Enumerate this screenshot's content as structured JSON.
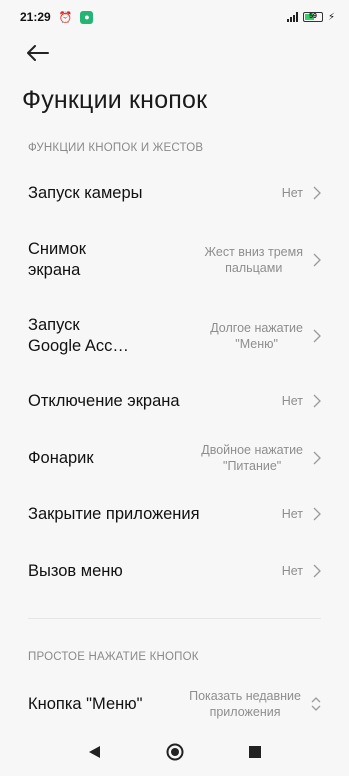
{
  "status_bar": {
    "time": "21:29",
    "alarm_icon": "alarm-clock-icon",
    "notification_icon": "app-notification-icon",
    "battery_level": "59",
    "accent": "#3ecb6a"
  },
  "header": {
    "title": "Функции кнопок"
  },
  "sections": [
    {
      "header": "ФУНКЦИИ КНОПОК И ЖЕСТОВ",
      "items": [
        {
          "label": "Запуск камеры",
          "value": "Нет"
        },
        {
          "label": "Снимок\nэкрана",
          "value": "Жест вниз тремя\nпальцами"
        },
        {
          "label": "Запуск\nGoogle Acc…",
          "value": "Долгое нажатие\n\"Меню\""
        },
        {
          "label": "Отключение экрана",
          "value": "Нет"
        },
        {
          "label": "Фонарик",
          "value": "Двойное нажатие\n\"Питание\""
        },
        {
          "label": "Закрытие приложения",
          "value": "Нет"
        },
        {
          "label": "Вызов меню",
          "value": "Нет"
        }
      ]
    },
    {
      "header": "ПРОСТОЕ НАЖАТИЕ КНОПОК",
      "items": [
        {
          "label": "Кнопка \"Меню\"",
          "value": "Показать недавние\nприложения"
        }
      ]
    }
  ],
  "navbar": {
    "back_icon": "triangle-back-icon",
    "home_icon": "circle-home-icon",
    "recents_icon": "square-recents-icon"
  }
}
